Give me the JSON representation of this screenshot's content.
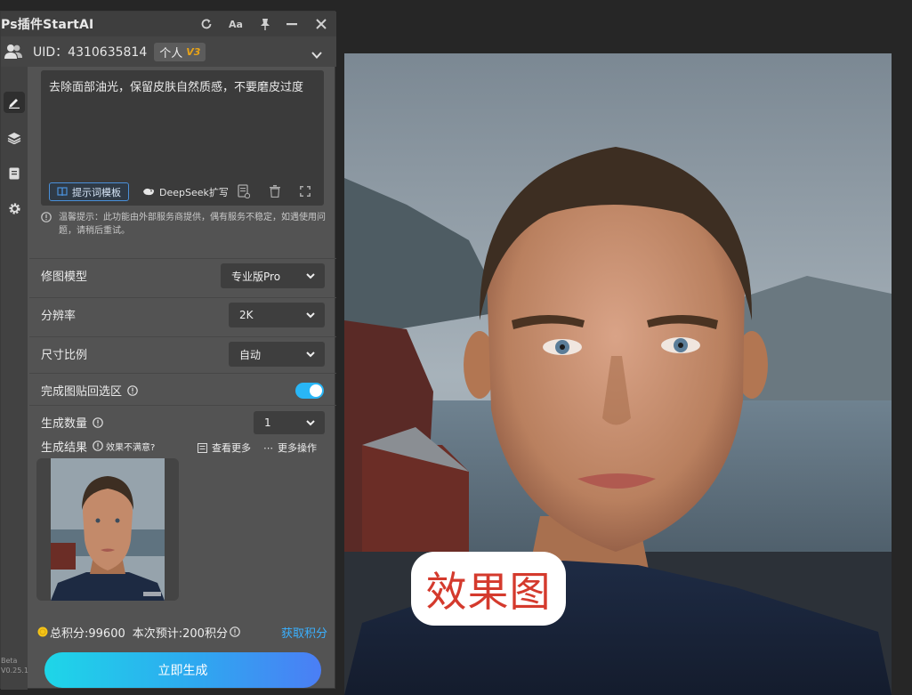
{
  "titlebar": {
    "title": "Ps插件StartAI"
  },
  "userbar": {
    "uid_text": "UID：4310635814",
    "plan_label": "个人",
    "plan_level": "V3"
  },
  "sidebar": {
    "beta_label": "Beta",
    "version": "V0.25.1"
  },
  "prompt": {
    "text": "去除面部油光，保留皮肤自然质感，不要磨皮过度",
    "template_button": "提示词模板",
    "deepseek_button": "DeepSeek扩写"
  },
  "notice": {
    "text": "温馨提示：此功能由外部服务商提供，偶有服务不稳定，如遇使用问题，请稍后重试。"
  },
  "settings": {
    "model_label": "修图模型",
    "model_value": "专业版Pro",
    "resolution_label": "分辨率",
    "resolution_value": "2K",
    "ratio_label": "尺寸比例",
    "ratio_value": "自动",
    "paste_label": "完成图贴回选区",
    "paste_enabled": true,
    "count_label": "生成数量",
    "count_value": "1"
  },
  "results": {
    "label": "生成结果",
    "unsatisfied": "效果不满意?",
    "view_more": "查看更多",
    "more_actions": "更多操作"
  },
  "footer": {
    "total_points": "总积分:99600",
    "estimate": "本次预计:200积分",
    "get_points": "获取积分"
  },
  "generate_button": "立即生成",
  "canvas": {
    "badge_text": "效果图"
  },
  "colors": {
    "accent": "#29b6f6",
    "link": "#3ab0ff",
    "badge_text": "#d43a2d"
  }
}
